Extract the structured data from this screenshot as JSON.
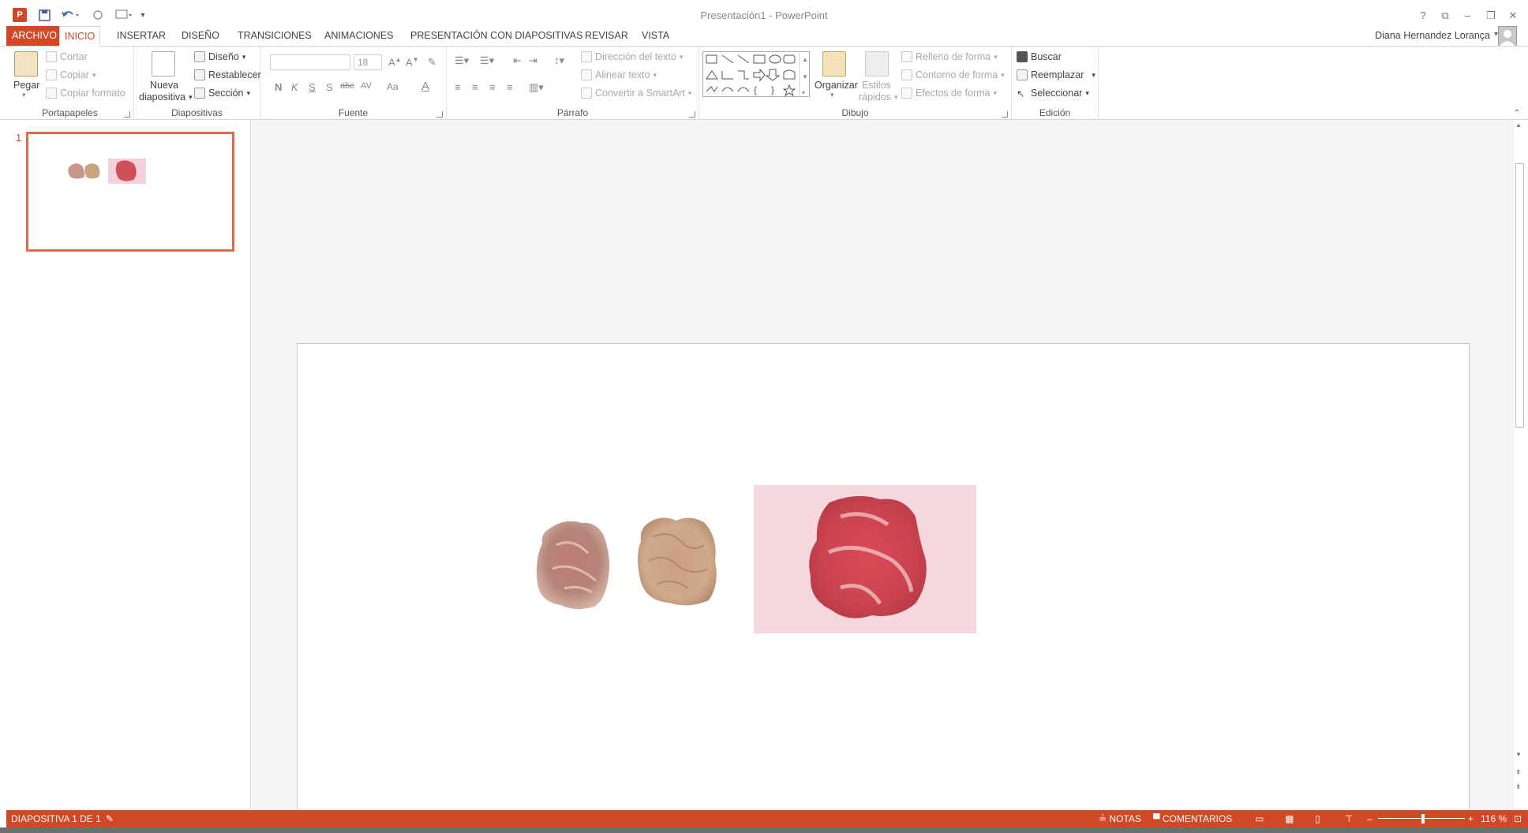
{
  "window": {
    "title": "Presentación1 - PowerPoint",
    "app_logo": "P",
    "controls": [
      "?",
      "⧉",
      "–",
      "❐",
      "✕"
    ]
  },
  "qat": {
    "icons": [
      "ppt-logo-icon",
      "save-icon",
      "undo-icon",
      "redo-icon",
      "start-presentation-icon",
      "customize-qat-icon"
    ]
  },
  "tabs": [
    "ARCHIVO",
    "INICIO",
    "INSERTAR",
    "DISEÑO",
    "TRANSICIONES",
    "ANIMACIONES",
    "PRESENTACIÓN CON DIAPOSITIVAS",
    "REVISAR",
    "VISTA"
  ],
  "active_tab": "INICIO",
  "user": {
    "name": "Diana Hernandez Lorança"
  },
  "ribbon": {
    "clipboard": {
      "label": "Portapapeles",
      "paste": "Pegar",
      "cut": "Cortar",
      "copy": "Copiar",
      "format_painter": "Copiar formato"
    },
    "slides": {
      "label": "Diapositivas",
      "new_slide_1": "Nueva",
      "new_slide_2": "diapositiva",
      "layout": "Diseño",
      "reset": "Restablecer",
      "section": "Sección"
    },
    "font": {
      "label": "Fuente",
      "font_name": "",
      "font_size": "18",
      "bold": "N",
      "italic": "K",
      "underline": "S",
      "shadow": "S",
      "strike": "abc",
      "spacing": "AV",
      "case": "Aa",
      "color": "A"
    },
    "paragraph": {
      "label": "Párrafo",
      "text_direction": "Dirección del texto",
      "align_text": "Alinear texto",
      "smartart": "Convertir a SmartArt"
    },
    "drawing": {
      "label": "Dibujo",
      "arrange": "Organizar",
      "quick_styles_1": "Estilos",
      "quick_styles_2": "rápidos",
      "shape_fill": "Relleno de forma",
      "shape_outline": "Contorno de forma",
      "shape_effects": "Efectos de forma"
    },
    "editing": {
      "label": "Edición",
      "find": "Buscar",
      "replace": "Reemplazar",
      "select": "Seleccionar"
    }
  },
  "thumbnails": {
    "slide_number": "1"
  },
  "statusbar": {
    "slide_info": "DIAPOSITIVA 1 DE 1",
    "notes": "NOTAS",
    "comments": "COMENTARIOS",
    "zoom": "116 %",
    "zoom_level_fraction": 0.52
  },
  "colors": {
    "accent": "#d24726",
    "thumb_border": "#e06a4c",
    "slide_bg": "#ffffff",
    "canvas_bg": "#f4f4f4"
  }
}
